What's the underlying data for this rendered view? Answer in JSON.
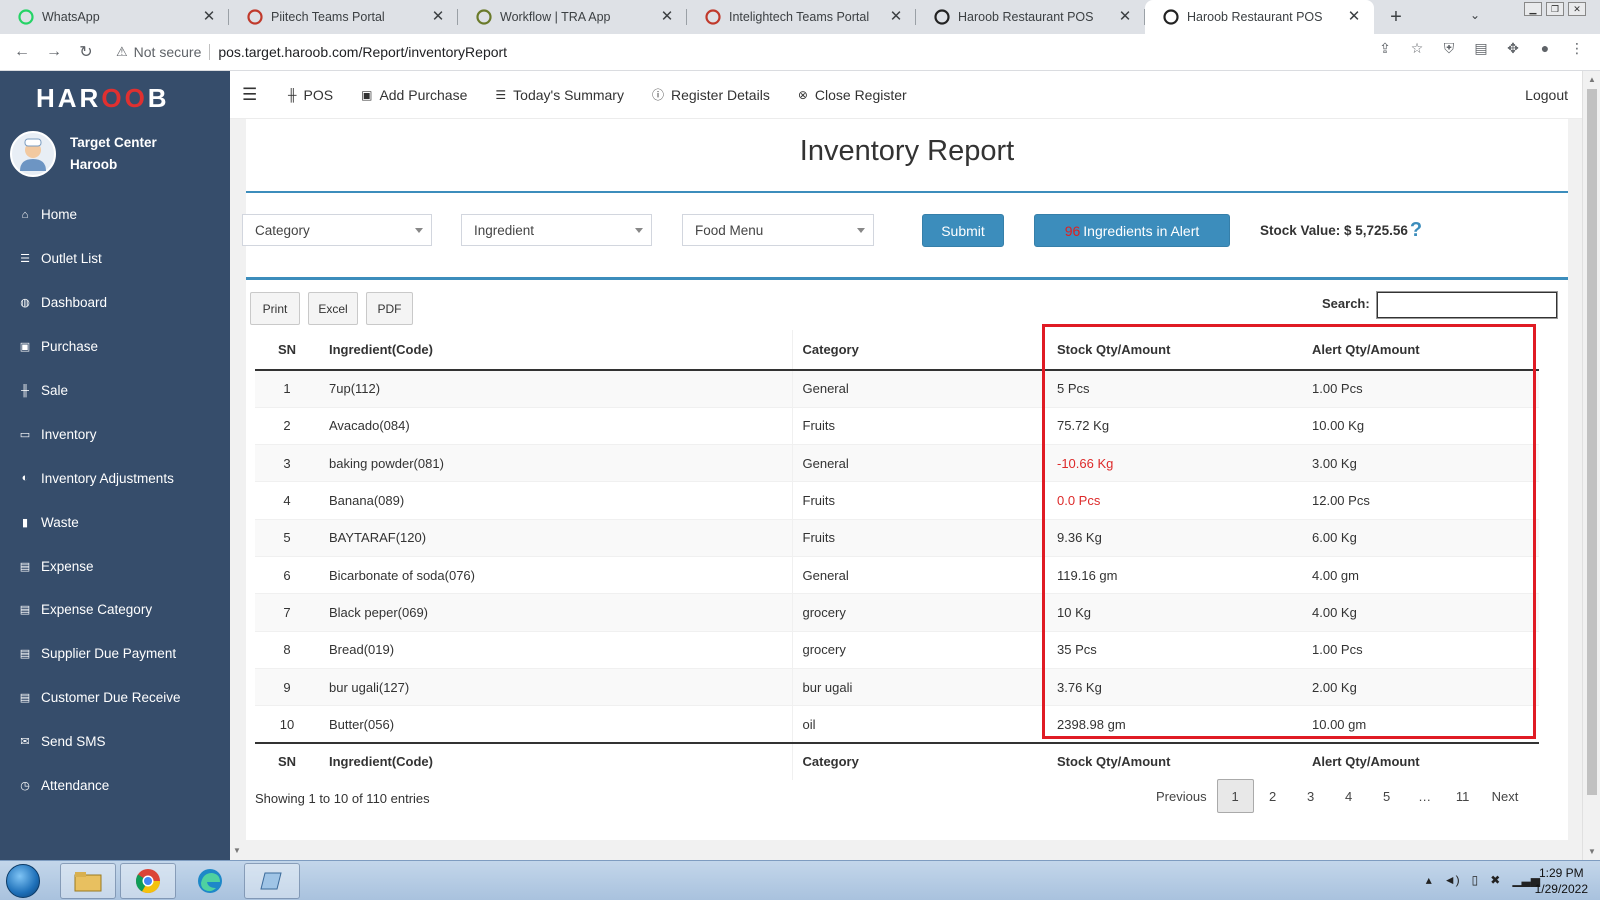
{
  "browser": {
    "tabs": [
      {
        "title": "WhatsApp",
        "icon": "whatsapp-icon",
        "color": "#25d366"
      },
      {
        "title": "Piitech Teams Portal",
        "icon": "teams-portal-icon",
        "color": "#c0392b"
      },
      {
        "title": "Workflow | TRA App",
        "icon": "tra-app-icon",
        "color": "#6a7a2a"
      },
      {
        "title": "Intelightech Teams Portal",
        "icon": "teams-portal-icon",
        "color": "#c0392b"
      },
      {
        "title": "Haroob Restaurant POS",
        "icon": "haroob-icon",
        "color": "#222222"
      },
      {
        "title": "Haroob Restaurant POS",
        "icon": "haroob-icon",
        "color": "#222222",
        "active": true
      }
    ],
    "new_tab": "+",
    "security_label": "Not secure",
    "url": "pos.target.haroob.com/Report/inventoryReport"
  },
  "sidebar": {
    "logo_prefix": "HAR",
    "logo_mid": "OO",
    "logo_suffix": "B",
    "user_line1": "Target Center",
    "user_line2": "Haroob",
    "items": [
      {
        "label": "Home",
        "icon": "home-icon",
        "glyph": "⌂"
      },
      {
        "label": "Outlet List",
        "icon": "list-icon",
        "glyph": "☰"
      },
      {
        "label": "Dashboard",
        "icon": "dashboard-icon",
        "glyph": "◍"
      },
      {
        "label": "Purchase",
        "icon": "truck-icon",
        "glyph": "▣"
      },
      {
        "label": "Sale",
        "icon": "cutlery-icon",
        "glyph": "╫"
      },
      {
        "label": "Inventory",
        "icon": "inbox-icon",
        "glyph": "▭"
      },
      {
        "label": "Inventory Adjustments",
        "icon": "adjust-icon",
        "glyph": "◐"
      },
      {
        "label": "Waste",
        "icon": "trash-icon",
        "glyph": "▮"
      },
      {
        "label": "Expense",
        "icon": "money-icon",
        "glyph": "▤"
      },
      {
        "label": "Expense Category",
        "icon": "list-alt-icon",
        "glyph": "▤"
      },
      {
        "label": "Supplier Due Payment",
        "icon": "money-icon",
        "glyph": "▤"
      },
      {
        "label": "Customer Due Receive",
        "icon": "money-icon",
        "glyph": "▤"
      },
      {
        "label": "Send SMS",
        "icon": "envelope-icon",
        "glyph": "✉"
      },
      {
        "label": "Attendance",
        "icon": "clock-icon",
        "glyph": "◷"
      }
    ]
  },
  "topnav": {
    "items": [
      {
        "label": "POS",
        "icon": "cutlery-icon",
        "glyph": "╫"
      },
      {
        "label": "Add Purchase",
        "icon": "truck-icon",
        "glyph": "▣"
      },
      {
        "label": "Today's Summary",
        "icon": "list-icon",
        "glyph": "☰"
      },
      {
        "label": "Register Details",
        "icon": "info-circle-icon",
        "glyph": "ⓘ"
      },
      {
        "label": "Close Register",
        "icon": "times-circle-icon",
        "glyph": "⊗"
      }
    ],
    "logout": "Logout"
  },
  "report": {
    "title": "Inventory Report",
    "filters": {
      "category": "Category",
      "ingredient": "Ingredient",
      "food_menu": "Food Menu"
    },
    "submit": "Submit",
    "alert_count": "96",
    "alert_label": "Ingredients in Alert",
    "stock_value": "Stock Value: $ 5,725.56",
    "help": "?",
    "export": {
      "print": "Print",
      "excel": "Excel",
      "pdf": "PDF"
    },
    "search_label": "Search:",
    "search_value": "",
    "columns": [
      "SN",
      "Ingredient(Code)",
      "Category",
      "Stock Qty/Amount",
      "Alert Qty/Amount"
    ],
    "rows": [
      {
        "sn": "1",
        "ingredient": "7up(112)",
        "category": "General",
        "stock": "5 Pcs",
        "alert": "1.00 Pcs",
        "negative": false
      },
      {
        "sn": "2",
        "ingredient": "Avacado(084)",
        "category": "Fruits",
        "stock": "75.72 Kg",
        "alert": "10.00 Kg",
        "negative": false
      },
      {
        "sn": "3",
        "ingredient": "baking powder(081)",
        "category": "General",
        "stock": "-10.66 Kg",
        "alert": "3.00 Kg",
        "negative": true
      },
      {
        "sn": "4",
        "ingredient": "Banana(089)",
        "category": "Fruits",
        "stock": "0.0 Pcs",
        "alert": "12.00 Pcs",
        "negative": true
      },
      {
        "sn": "5",
        "ingredient": "BAYTARAF(120)",
        "category": "Fruits",
        "stock": "9.36 Kg",
        "alert": "6.00 Kg",
        "negative": false
      },
      {
        "sn": "6",
        "ingredient": "Bicarbonate of soda(076)",
        "category": "General",
        "stock": "119.16 gm",
        "alert": "4.00 gm",
        "negative": false
      },
      {
        "sn": "7",
        "ingredient": "Black peper(069)",
        "category": "grocery",
        "stock": "10 Kg",
        "alert": "4.00 Kg",
        "negative": false
      },
      {
        "sn": "8",
        "ingredient": "Bread(019)",
        "category": "grocery",
        "stock": "35 Pcs",
        "alert": "1.00 Pcs",
        "negative": false
      },
      {
        "sn": "9",
        "ingredient": "bur ugali(127)",
        "category": "bur ugali",
        "stock": "3.76 Kg",
        "alert": "2.00 Kg",
        "negative": false
      },
      {
        "sn": "10",
        "ingredient": "Butter(056)",
        "category": "oil",
        "stock": "2398.98 gm",
        "alert": "10.00 gm",
        "negative": false
      }
    ],
    "entries_info": "Showing 1 to 10 of 110 entries",
    "pagination": [
      "Previous",
      "1",
      "2",
      "3",
      "4",
      "5",
      "…",
      "11",
      "Next"
    ],
    "current_page": "1",
    "highlight_color": "#e01b24",
    "accent_color": "#3c8dbc"
  },
  "taskbar": {
    "time": "1:29 PM",
    "date": "1/29/2022"
  }
}
